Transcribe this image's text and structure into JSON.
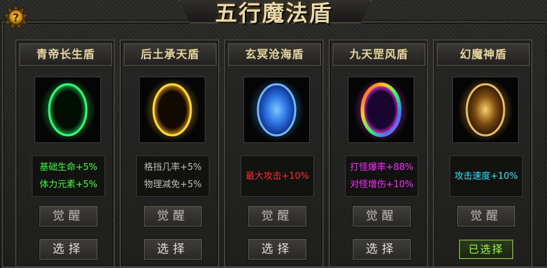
{
  "title": "五行魔法盾",
  "help_icon": "question-mark-icon",
  "colors": {
    "header_text": "#e8d8a2",
    "green": "#39ff39",
    "gray": "#bdbdbd",
    "red": "#ff2a2a",
    "magenta": "#ff28ff",
    "cyan": "#28e8ff",
    "selected_green": "#9bff3c"
  },
  "shields": [
    {
      "name": "青帝长生盾",
      "orb_icon": "green-shield-orb-icon",
      "stats": [
        "基础生命+5%",
        "体力元素+5%"
      ],
      "stat_color": "#39ff39",
      "awaken_label": "觉醒",
      "select_label": "选择",
      "selected": false
    },
    {
      "name": "后土承天盾",
      "orb_icon": "gold-shield-orb-icon",
      "stats": [
        "格挡几率+5%",
        "物理减免+5%"
      ],
      "stat_color": "#bdbdbd",
      "awaken_label": "觉醒",
      "select_label": "选择",
      "selected": false
    },
    {
      "name": "玄冥沧海盾",
      "orb_icon": "blue-shield-orb-icon",
      "stats": [
        "最大攻击+10%"
      ],
      "stat_color": "#ff2a2a",
      "awaken_label": "觉醒",
      "select_label": "选择",
      "selected": false
    },
    {
      "name": "九天罡风盾",
      "orb_icon": "rainbow-shield-orb-icon",
      "stats": [
        "打怪爆率+88%",
        "对怪增伤+10%"
      ],
      "stat_color": "#ff28ff",
      "awaken_label": "觉醒",
      "select_label": "选择",
      "selected": false
    },
    {
      "name": "幻魔神盾",
      "orb_icon": "amber-shield-orb-icon",
      "stats": [
        "攻击速度+10%"
      ],
      "stat_color": "#28e8ff",
      "awaken_label": "觉醒",
      "select_label": "已选择",
      "selected": true
    }
  ]
}
